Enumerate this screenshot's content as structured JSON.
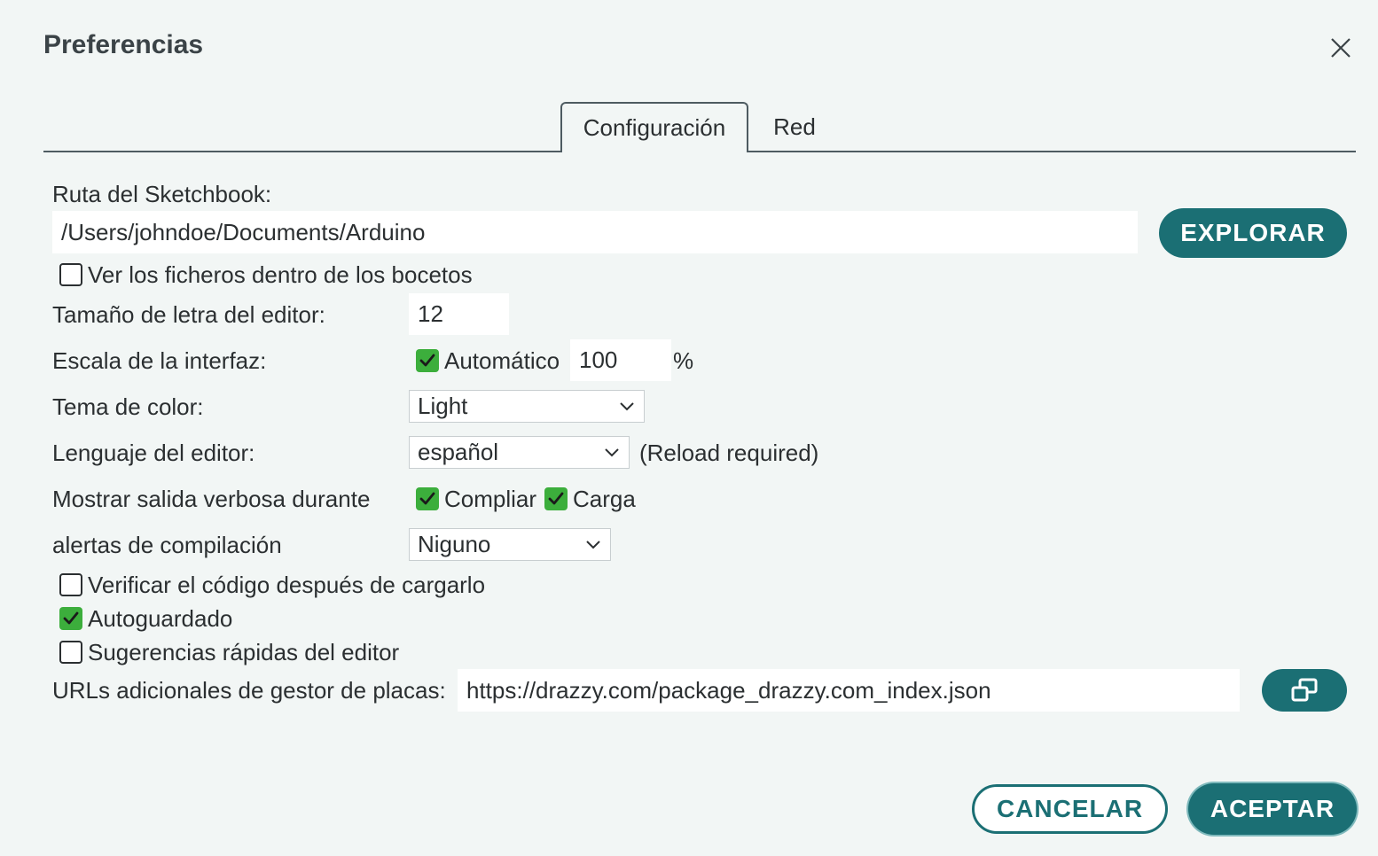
{
  "dialog": {
    "title": "Preferencias",
    "close_icon": "close-icon"
  },
  "tabs": [
    {
      "label": "Configuración",
      "active": true
    },
    {
      "label": "Red",
      "active": false
    }
  ],
  "sketchbook": {
    "label": "Ruta del Sketchbook:",
    "value": "/Users/johndoe/Documents/Arduino",
    "browse_label": "EXPLORAR"
  },
  "show_files": {
    "label": "Ver los ficheros dentro de los bocetos",
    "checked": false
  },
  "font_size": {
    "label": "Tamaño de letra del editor:",
    "value": "12"
  },
  "interface_scale": {
    "label": "Escala de la interfaz:",
    "auto_label": "Automático",
    "auto_checked": true,
    "value": "100",
    "unit": "%"
  },
  "theme": {
    "label": "Tema de color:",
    "selected": "Light"
  },
  "language": {
    "label": "Lenguaje del editor:",
    "selected": "español",
    "note": "(Reload required)"
  },
  "verbose": {
    "label": "Mostrar salida verbosa durante",
    "compile_label": "Compliar",
    "compile_checked": true,
    "upload_label": "Carga",
    "upload_checked": true
  },
  "warnings": {
    "label": "alertas de compilación",
    "selected": "Niguno"
  },
  "verify_after_upload": {
    "label": "Verificar el código después de cargarlo",
    "checked": false
  },
  "autosave": {
    "label": "Autoguardado",
    "checked": true
  },
  "quick_suggestions": {
    "label": "Sugerencias rápidas del editor",
    "checked": false
  },
  "board_urls": {
    "label": "URLs adicionales de gestor de placas:",
    "value": "https://drazzy.com/package_drazzy.com_index.json",
    "edit_icon": "open-window-icon"
  },
  "footer": {
    "cancel_label": "CANCELAR",
    "ok_label": "ACEPTAR"
  },
  "colors": {
    "accent": "#1b6f74",
    "check": "#3cae3c",
    "background": "#f2f6f5"
  }
}
